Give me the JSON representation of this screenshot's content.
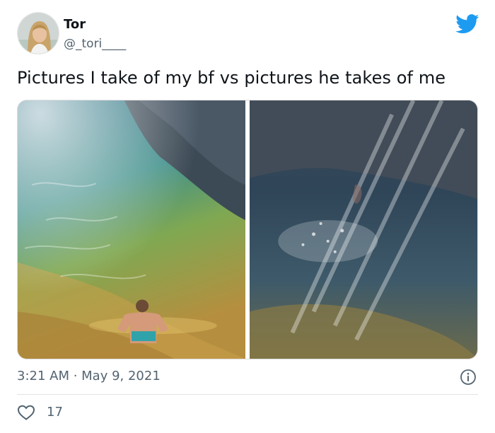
{
  "tweet": {
    "author": {
      "name": "Tor",
      "handle": "@_tori____"
    },
    "text": "Pictures I take of my bf vs pictures he takes of me",
    "timestamp": "3:21 AM · May 9, 2021",
    "likes": "17",
    "icons": {
      "platform": "twitter-bird-icon",
      "info": "info-icon",
      "like": "heart-icon"
    },
    "colors": {
      "brand": "#1d9bf0",
      "secondary_text": "#536471"
    }
  }
}
